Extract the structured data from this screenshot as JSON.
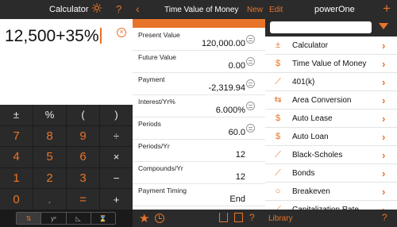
{
  "colors": {
    "accent": "#e8742a",
    "bar": "#2b2b2b",
    "keypad": "#2a2a2a"
  },
  "calculator": {
    "title": "Calculator",
    "expression": "12,500+35%",
    "keys": [
      {
        "label": "±",
        "kind": "op"
      },
      {
        "label": "%",
        "kind": "op"
      },
      {
        "label": "(",
        "kind": "op"
      },
      {
        "label": ")",
        "kind": "op"
      },
      {
        "label": "7",
        "kind": "num"
      },
      {
        "label": "8",
        "kind": "num"
      },
      {
        "label": "9",
        "kind": "num"
      },
      {
        "label": "÷",
        "kind": "op"
      },
      {
        "label": "4",
        "kind": "num"
      },
      {
        "label": "5",
        "kind": "num"
      },
      {
        "label": "6",
        "kind": "num"
      },
      {
        "label": "×",
        "kind": "op"
      },
      {
        "label": "1",
        "kind": "num"
      },
      {
        "label": "2",
        "kind": "num"
      },
      {
        "label": "3",
        "kind": "num"
      },
      {
        "label": "−",
        "kind": "op"
      },
      {
        "label": "0",
        "kind": "num"
      },
      {
        "label": ".",
        "kind": "num"
      },
      {
        "label": "=",
        "kind": "num"
      },
      {
        "label": "+",
        "kind": "op"
      }
    ],
    "backspace_icon": "backspace-arrow-icon",
    "tabs": [
      {
        "icon": "sort-icon",
        "label": "⇅",
        "active": true
      },
      {
        "icon": "power-icon",
        "label": "yˣ",
        "active": false
      },
      {
        "icon": "geometry-icon",
        "label": "◺",
        "active": false
      },
      {
        "icon": "hourglass-icon",
        "label": "⌛",
        "active": false
      }
    ]
  },
  "tvm": {
    "title": "Time Value of Money",
    "new_label": "New",
    "rows": [
      {
        "label": "Present Value",
        "value": "120,000.00",
        "stack": true
      },
      {
        "label": "Future Value",
        "value": "0.00",
        "stack": true
      },
      {
        "label": "Payment",
        "value": "-2,319.94",
        "stack": true
      },
      {
        "label": "Interest/Yr%",
        "value": "6.000%",
        "stack": true
      },
      {
        "label": "Periods",
        "value": "60.0",
        "stack": true
      },
      {
        "label": "Periods/Yr",
        "value": "12",
        "stack": false
      },
      {
        "label": "Compounds/Yr",
        "value": "12",
        "stack": false
      },
      {
        "label": "Payment Timing",
        "value": "End",
        "stack": false
      }
    ]
  },
  "library": {
    "title": "powerOne",
    "edit_label": "Edit",
    "footer_label": "Library",
    "items": [
      {
        "label": "Calculator",
        "icon": "calculator-icon",
        "glyph": "±"
      },
      {
        "label": "Time Value of Money",
        "icon": "dollar-icon",
        "glyph": "$"
      },
      {
        "label": "401(k)",
        "icon": "trend-icon",
        "glyph": "⟋"
      },
      {
        "label": "Area Conversion",
        "icon": "swap-icon",
        "glyph": "⇆"
      },
      {
        "label": "Auto Lease",
        "icon": "dollar-icon",
        "glyph": "$"
      },
      {
        "label": "Auto Loan",
        "icon": "dollar-icon",
        "glyph": "$"
      },
      {
        "label": "Black-Scholes",
        "icon": "trend-icon",
        "glyph": "⟋"
      },
      {
        "label": "Bonds",
        "icon": "trend-icon",
        "glyph": "⟋"
      },
      {
        "label": "Breakeven",
        "icon": "bulb-icon",
        "glyph": "○"
      },
      {
        "label": "Capitalization Rate",
        "icon": "trend-icon",
        "glyph": "⟋"
      }
    ]
  }
}
